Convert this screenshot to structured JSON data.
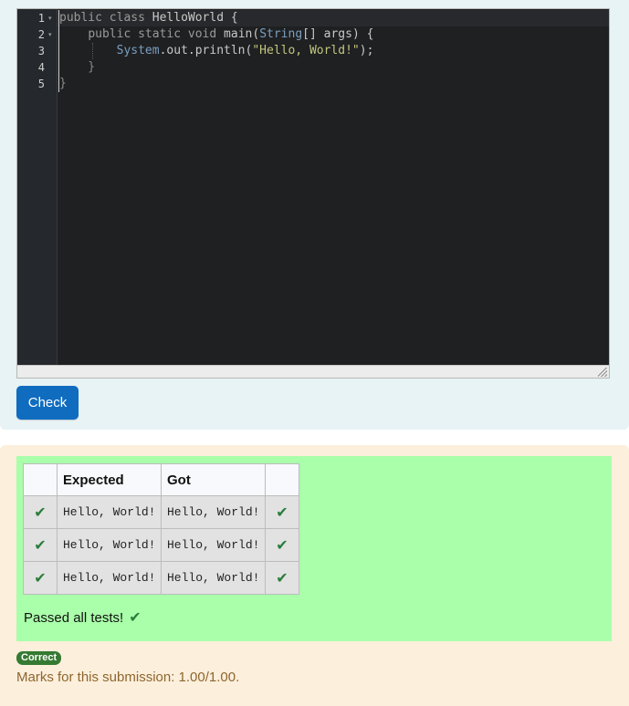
{
  "editor": {
    "line_numbers": [
      "1",
      "2",
      "3",
      "4",
      "5"
    ],
    "lines": [
      {
        "tokens": [
          {
            "t": "public",
            "c": "kw"
          },
          {
            "t": " ",
            "c": "plain"
          },
          {
            "t": "class",
            "c": "kw"
          },
          {
            "t": " HelloWorld {",
            "c": "plain"
          }
        ]
      },
      {
        "tokens": [
          {
            "t": "    ",
            "c": "plain"
          },
          {
            "t": "public",
            "c": "kw"
          },
          {
            "t": " ",
            "c": "plain"
          },
          {
            "t": "static",
            "c": "kw"
          },
          {
            "t": " ",
            "c": "plain"
          },
          {
            "t": "void",
            "c": "kw"
          },
          {
            "t": " main(",
            "c": "plain"
          },
          {
            "t": "String",
            "c": "type"
          },
          {
            "t": "[] args) {",
            "c": "plain"
          }
        ]
      },
      {
        "tokens": [
          {
            "t": "        ",
            "c": "plain"
          },
          {
            "t": "System",
            "c": "type"
          },
          {
            "t": ".out.println(",
            "c": "plain"
          },
          {
            "t": "\"Hello, World!\"",
            "c": "str"
          },
          {
            "t": ");",
            "c": "plain"
          }
        ]
      },
      {
        "tokens": [
          {
            "t": "    }",
            "c": "punct"
          }
        ]
      },
      {
        "tokens": [
          {
            "t": "}",
            "c": "punct"
          }
        ]
      }
    ]
  },
  "check_button": {
    "label": "Check"
  },
  "results": {
    "headers": {
      "expected": "Expected",
      "got": "Got"
    },
    "rows": [
      {
        "expected": "Hello, World!",
        "got": "Hello, World!",
        "status": "pass"
      },
      {
        "expected": "Hello, World!",
        "got": "Hello, World!",
        "status": "pass"
      },
      {
        "expected": "Hello, World!",
        "got": "Hello, World!",
        "status": "pass"
      }
    ],
    "tick_glyph": "✔",
    "summary": "Passed all tests!"
  },
  "grade": {
    "badge": "Correct",
    "marks_text": "Marks for this submission: 1.00/1.00."
  },
  "colors": {
    "editor_bg": "#1f2022",
    "check_button": "#0f6cbf",
    "pass_background": "#aaffaa",
    "tick": "#2a7d3b",
    "badge": "#357a32",
    "marks_text": "#8e662e"
  },
  "icons": {
    "fold": "fold-arrow-icon",
    "tick": "check-mark-icon",
    "resize": "resize-grip-icon"
  }
}
